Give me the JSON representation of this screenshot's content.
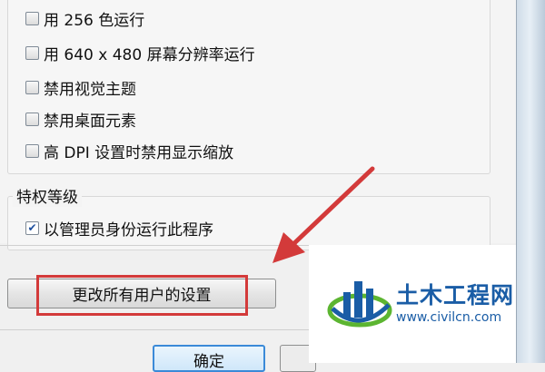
{
  "settings_group": {
    "options": [
      {
        "label": "用 256 色运行",
        "checked": false
      },
      {
        "label": "用 640 x 480 屏幕分辨率运行",
        "checked": false
      },
      {
        "label": "禁用视觉主题",
        "checked": false
      },
      {
        "label": "禁用桌面元素",
        "checked": false
      },
      {
        "label": "高 DPI 设置时禁用显示缩放",
        "checked": false
      }
    ]
  },
  "privilege_group": {
    "title": "特权等级",
    "option": {
      "label": "以管理员身份运行此程序",
      "checked": true
    }
  },
  "buttons": {
    "change_all_users": "更改所有用户的设置",
    "ok": "确定"
  },
  "watermark": {
    "name": "土木工程网",
    "url": "www.civilcn.com"
  },
  "colors": {
    "highlight": "#d33a3a",
    "arrow": "#d33a3a",
    "logo_blue": "#1a5da6",
    "logo_green": "#5cb531"
  }
}
